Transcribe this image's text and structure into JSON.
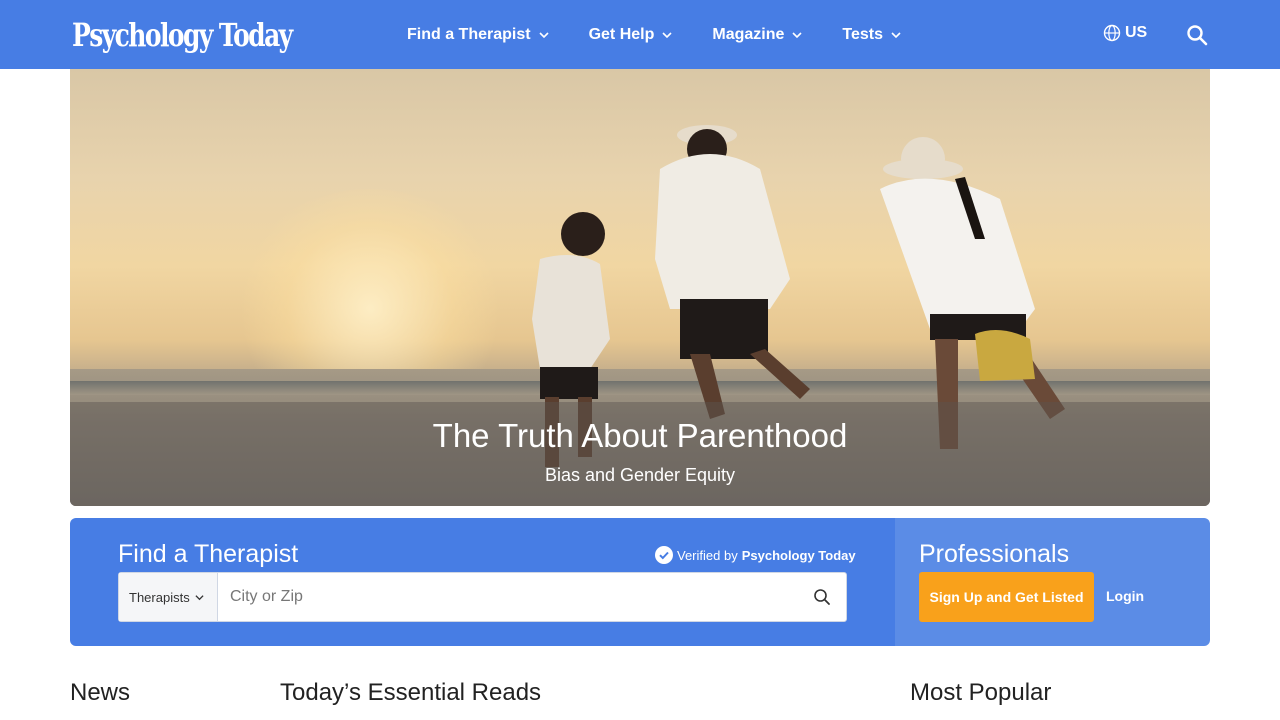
{
  "header": {
    "logo": "Psychology Today",
    "nav": [
      {
        "label": "Find a Therapist"
      },
      {
        "label": "Get Help"
      },
      {
        "label": "Magazine"
      },
      {
        "label": "Tests"
      }
    ],
    "region": "US",
    "brand_color": "#477de4"
  },
  "hero": {
    "title": "The Truth About Parenthood",
    "subtitle": "Bias and Gender Equity"
  },
  "finder": {
    "title": "Find a Therapist",
    "verified_prefix": "Verified by",
    "verified_brand": "Psychology Today",
    "type_selected": "Therapists",
    "city_placeholder": "City or Zip"
  },
  "professionals": {
    "title": "Professionals",
    "signup_label": "Sign Up and Get Listed",
    "login_label": "Login",
    "accent_color": "#f9a11b"
  },
  "sections": {
    "news": "News",
    "essential": "Today’s Essential Reads",
    "popular": "Most Popular"
  }
}
